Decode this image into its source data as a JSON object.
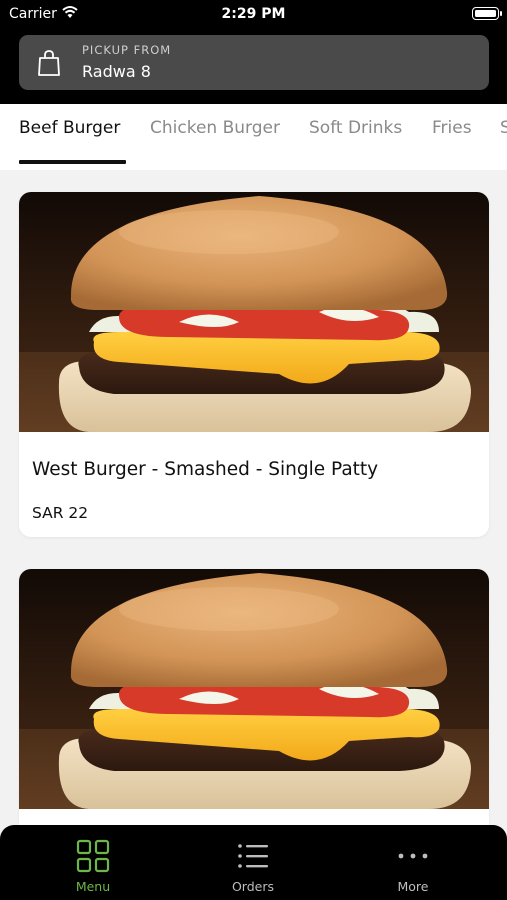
{
  "status_bar": {
    "carrier": "Carrier",
    "time": "2:29 PM"
  },
  "pickup": {
    "label": "PICKUP FROM",
    "location": "Radwa 8",
    "icon": "shopping-bag-icon"
  },
  "tabs": [
    {
      "label": "Beef Burger",
      "active": true
    },
    {
      "label": "Chicken Burger",
      "active": false
    },
    {
      "label": "Soft Drinks",
      "active": false
    },
    {
      "label": "Fries",
      "active": false
    },
    {
      "label": "S",
      "active": false
    }
  ],
  "products": [
    {
      "name": "West Burger - Smashed - Single Patty",
      "price": "SAR 22",
      "image": "burger-photo"
    },
    {
      "name": "",
      "price": "",
      "image": "burger-photo"
    }
  ],
  "bottom_nav": [
    {
      "label": "Menu",
      "icon": "grid-icon",
      "active": true
    },
    {
      "label": "Orders",
      "icon": "list-icon",
      "active": false
    },
    {
      "label": "More",
      "icon": "more-dots-icon",
      "active": false
    }
  ],
  "colors": {
    "accent": "#6cb64a",
    "header_bg": "#000000",
    "pickup_bg": "#4a4a4a",
    "page_bg": "#f2f2f2"
  }
}
